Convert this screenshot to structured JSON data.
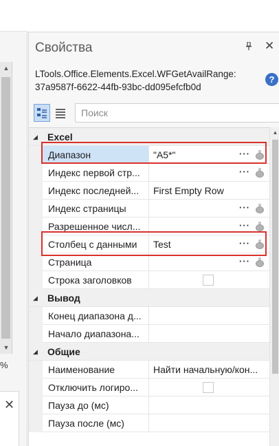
{
  "left_pane": {
    "percent_label": "%",
    "close_label": "✕"
  },
  "panel": {
    "title": "Свойства",
    "pin_label": "📌",
    "close_label": "✕",
    "type_name": "LTools.Office.Elements.Excel.WFGetAvailRange: 37a9587f-6622-44fb-93bc-dd095efcfb0d",
    "help_label": "?"
  },
  "toolbar": {
    "search_placeholder": "Поиск"
  },
  "grid": {
    "categories": [
      {
        "label": "Excel",
        "rows": [
          {
            "name": "Диапазон",
            "value": "\"A5*\"",
            "ellipsis": "···",
            "has_flask": true,
            "selected": true
          },
          {
            "name": "Индекс первой стр...",
            "value": "",
            "ellipsis": "···",
            "has_flask": true
          },
          {
            "name": "Индекс последней...",
            "value": "First Empty Row",
            "ellipsis": "",
            "has_flask": false
          },
          {
            "name": "Индекс страницы",
            "value": "",
            "ellipsis": "···",
            "has_flask": true
          },
          {
            "name": "Разрешенное числ...",
            "value": "",
            "ellipsis": "···",
            "has_flask": true
          },
          {
            "name": "Столбец с данными",
            "value": "Test",
            "ellipsis": "···",
            "has_flask": true
          },
          {
            "name": "Страница",
            "value": "",
            "ellipsis": "···",
            "has_flask": true
          },
          {
            "name": "Строка заголовков",
            "value": "",
            "checkbox": true
          }
        ]
      },
      {
        "label": "Вывод",
        "rows": [
          {
            "name": "Конец диапазона д...",
            "value": ""
          },
          {
            "name": "Начало диапазона...",
            "value": ""
          }
        ]
      },
      {
        "label": "Общие",
        "rows": [
          {
            "name": "Наименование",
            "value": "Найти начальную/кон..."
          },
          {
            "name": "Отключить логиро...",
            "value": "",
            "checkbox": true
          },
          {
            "name": "Пауза до (мс)",
            "value": ""
          },
          {
            "name": "Пауза после (мс)",
            "value": ""
          }
        ]
      }
    ]
  },
  "colors": {
    "highlight": "#d9312b",
    "selection": "#cfe3f7",
    "help_icon": "#3a70c7"
  }
}
